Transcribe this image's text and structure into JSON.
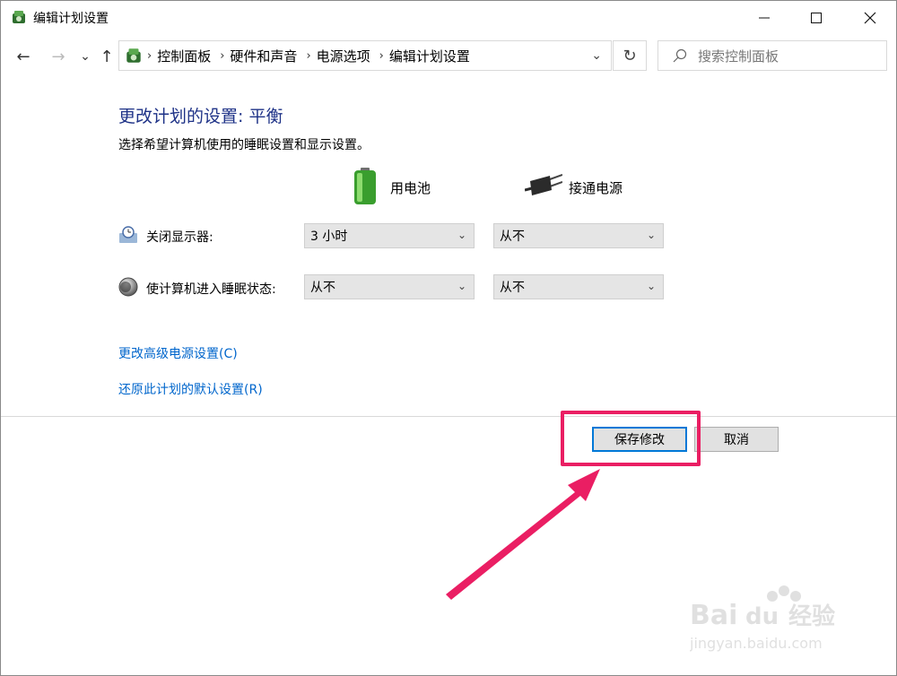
{
  "window": {
    "title": "编辑计划设置",
    "controls": {
      "minimize": "—",
      "maximize": "☐",
      "close": "✕"
    }
  },
  "nav": {
    "back": "←",
    "forward": "→",
    "history": "⌄",
    "up": "↑",
    "breadcrumb": [
      "控制面板",
      "硬件和声音",
      "电源选项",
      "编辑计划设置"
    ],
    "dropdown": "⌄",
    "refresh": "↻",
    "search_placeholder": "搜索控制面板"
  },
  "content": {
    "heading": "更改计划的设置: 平衡",
    "subtitle": "选择希望计算机使用的睡眠设置和显示设置。",
    "columns": {
      "battery": "用电池",
      "plugged": "接通电源"
    },
    "rows": [
      {
        "label": "关闭显示器:",
        "battery": "3 小时",
        "plugged": "从不"
      },
      {
        "label": "使计算机进入睡眠状态:",
        "battery": "从不",
        "plugged": "从不"
      }
    ],
    "links": {
      "advanced": "更改高级电源设置(C)",
      "restore": "还原此计划的默认设置(R)"
    }
  },
  "buttons": {
    "save": "保存修改",
    "cancel": "取消"
  },
  "annotation": {
    "color": "#ea1e63"
  },
  "watermark": {
    "brand": "Baidu经验",
    "url": "jingyan.baidu.com"
  },
  "colors": {
    "heading": "#1e3287",
    "link": "#0066cc",
    "focus": "#0078d7"
  }
}
